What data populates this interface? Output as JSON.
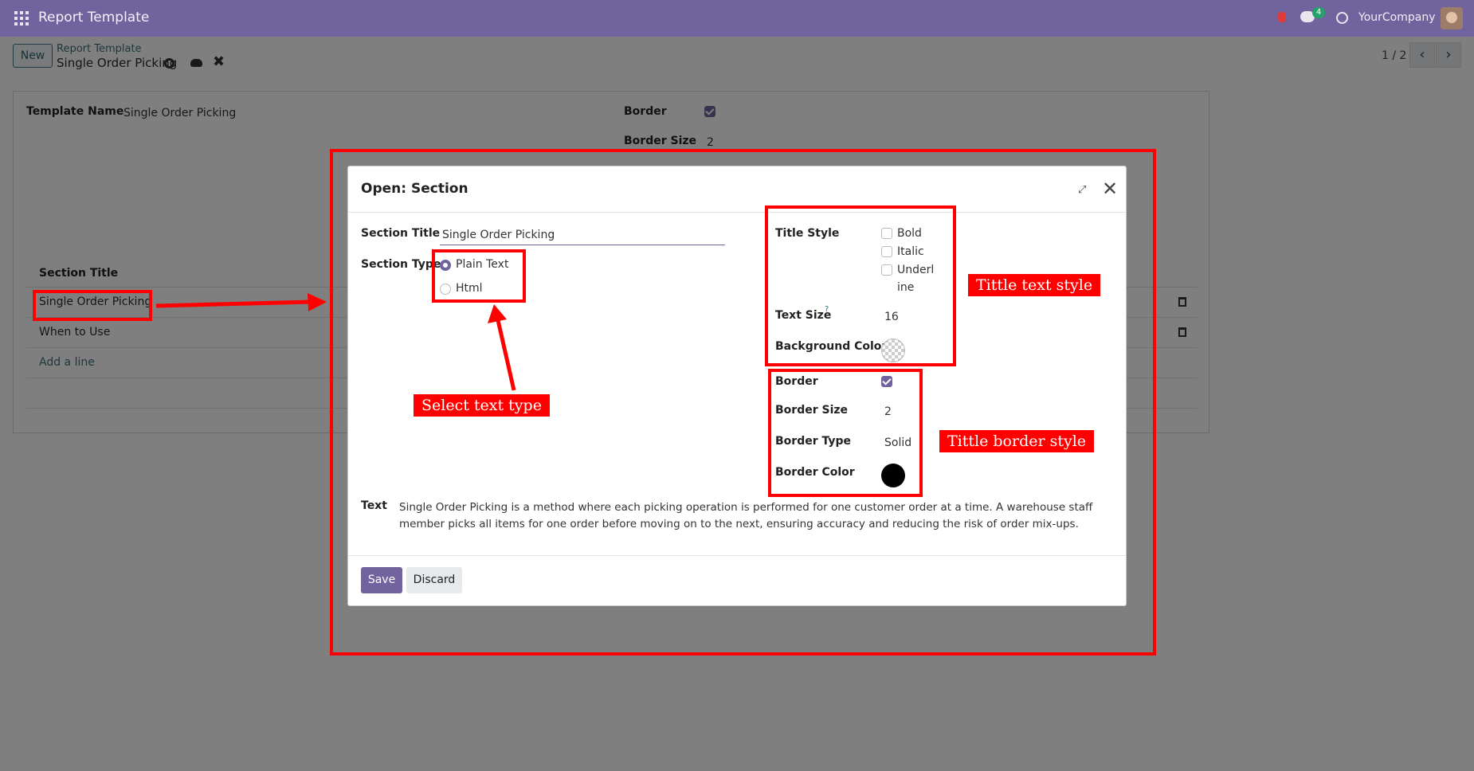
{
  "topbar": {
    "app_title": "Report Template",
    "chat_badge": "4",
    "company": "YourCompany"
  },
  "control": {
    "new_label": "New",
    "breadcrumb_parent": "Report Template",
    "breadcrumb_current": "Single Order Picking",
    "discard_symbol": "✖",
    "pager": "1 / 2",
    "prev_symbol": "‹",
    "next_symbol": "›"
  },
  "form": {
    "template_name_label": "Template Name",
    "template_name_value": "Single Order Picking",
    "border_label": "Border",
    "border_size_label": "Border Size",
    "border_size_value": "2",
    "table_header": "Section Title",
    "rows": [
      "Single Order Picking",
      "When to Use"
    ],
    "add_line": "Add a line"
  },
  "modal": {
    "title": "Open: Section",
    "close_symbol": "✕",
    "expand_symbol": "⤢",
    "section_title_label": "Section Title",
    "section_title_value": "Single Order Picking",
    "section_type_label": "Section Type",
    "type_options": [
      "Plain Text",
      "Html"
    ],
    "selected_type": "Plain Text",
    "title_style_label": "Title Style",
    "style_options": [
      "Bold",
      "Italic",
      "Underl",
      "ine"
    ],
    "text_size_label": "Text Size",
    "text_size_help": "?",
    "text_size_value": "16",
    "bg_color_label": "Background Color",
    "border_label": "Border",
    "border_checked": true,
    "border_size_label": "Border Size",
    "border_size_value": "2",
    "border_type_label": "Border Type",
    "border_type_value": "Solid",
    "border_color_label": "Border Color",
    "border_color": "#000000",
    "text_label": "Text",
    "text_value": "Single Order Picking is a method where each picking operation is performed for one customer order at a time. A warehouse staff member picks all items for one order before moving on to the next, ensuring accuracy and reducing the risk of order mix-ups.",
    "save_label": "Save",
    "discard_label": "Discard"
  },
  "annotations": {
    "select_text_type": "Select text type",
    "title_text_style": "Tittle text style",
    "title_border_style": "Tittle border style"
  },
  "colors": {
    "brand": "#71639e",
    "annotation_red": "#ff0000"
  }
}
